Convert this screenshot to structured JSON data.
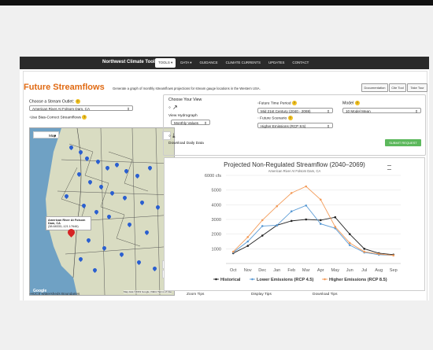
{
  "nav": {
    "brand": "Northwest Climate Toolbox",
    "items": [
      "TOOLS ▾",
      "DATA ▾",
      "GUIDANCE",
      "CLIMATE CURRENTS",
      "UPDATES",
      "CONTACT"
    ]
  },
  "header": {
    "title": "Future Streamflows",
    "subtitle": "Generate a graph of monthly streamflows projections for stream gauge locations in the Western USA.",
    "buttons": [
      "Documentation",
      "Cite Tool",
      "Take Tour"
    ]
  },
  "left": {
    "outlet_label": "Choose a Stream Outlet:",
    "outlet_value": "American River At Folsom Dam, CA",
    "bias_label": "Use Bias-Correct Streamflows",
    "map_type": "Map",
    "tooltip_title": "American River At Folsom Dam, CA",
    "tooltip_coords": "(38.68333,-121.17646)",
    "google": "Google",
    "map_footer": "Map data ©2019 Google, INEGI  Terms of Use",
    "huc_label": "HUC8 Watersheds Boundaries"
  },
  "view": {
    "label": "Choose Your View",
    "hydrograph": "View Hydrograph",
    "hydro_value": "Monthly Values",
    "download": "Download Daily Data"
  },
  "period": {
    "label": "Future Time Period",
    "value": "Mid 21st Century (2040 - 2069)"
  },
  "scenario": {
    "label": "Future Scenario",
    "value": "Higher Emissions (RCP 8.5)"
  },
  "model": {
    "label": "Model",
    "value": "10 Model Mean"
  },
  "submit": "SUBMIT REQUEST",
  "tips": [
    "Zoom Tips",
    "Display Tips",
    "Download Tips"
  ],
  "colors": {
    "accent": "#e06a13",
    "historical": "#222222",
    "lower": "#5b9bd5",
    "higher": "#f39c5a"
  },
  "chart_data": {
    "type": "line",
    "title": "Projected Non-Regulated Streamflow (2040–2069)",
    "subtitle": "American River At Folsom Dam, CA",
    "categories": [
      "Oct",
      "Nov",
      "Dec",
      "Jan",
      "Feb",
      "Mar",
      "Apr",
      "May",
      "Jun",
      "Jul",
      "Aug",
      "Sep"
    ],
    "ylim": [
      0,
      6000
    ],
    "yticks": [
      1000,
      2000,
      3000,
      4000,
      5000,
      6000
    ],
    "ytick_labels": [
      "1000",
      "2000",
      "3000",
      "4000",
      "5000",
      "6000 cfs"
    ],
    "series": [
      {
        "name": "Historical",
        "values": [
          700,
          1200,
          1900,
          2600,
          2900,
          3000,
          2950,
          3150,
          2000,
          1000,
          700,
          600
        ]
      },
      {
        "name": "Lower Emissions (RCP 4.5)",
        "values": [
          750,
          1500,
          2550,
          2600,
          3550,
          3950,
          2700,
          2400,
          1250,
          750,
          600,
          550
        ]
      },
      {
        "name": "Higher Emissions (RCP 8.5)",
        "values": [
          800,
          1800,
          2950,
          3900,
          4800,
          5250,
          4350,
          2500,
          1400,
          800,
          650,
          550
        ]
      }
    ]
  }
}
